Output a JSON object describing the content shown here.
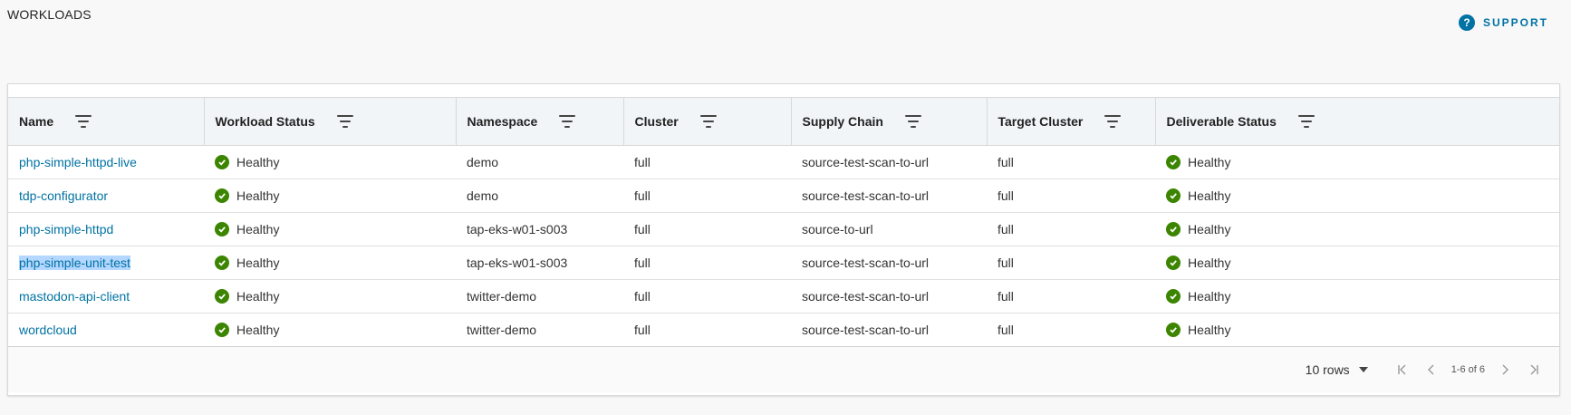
{
  "page": {
    "title": "WORKLOADS"
  },
  "support": {
    "label": "SUPPORT",
    "icon": "help-circle-icon",
    "color": "#0072a3"
  },
  "table": {
    "columns": [
      "Name",
      "Workload Status",
      "Namespace",
      "Cluster",
      "Supply Chain",
      "Target Cluster",
      "Deliverable Status"
    ],
    "rows": [
      {
        "name": "php-simple-httpd-live",
        "workload_status": "Healthy",
        "namespace": "demo",
        "cluster": "full",
        "supply_chain": "source-test-scan-to-url",
        "target_cluster": "full",
        "deliverable_status": "Healthy"
      },
      {
        "name": "tdp-configurator",
        "workload_status": "Healthy",
        "namespace": "demo",
        "cluster": "full",
        "supply_chain": "source-test-scan-to-url",
        "target_cluster": "full",
        "deliverable_status": "Healthy"
      },
      {
        "name": "php-simple-httpd",
        "workload_status": "Healthy",
        "namespace": "tap-eks-w01-s003",
        "cluster": "full",
        "supply_chain": "source-to-url",
        "target_cluster": "full",
        "deliverable_status": "Healthy"
      },
      {
        "name": "php-simple-unit-test",
        "workload_status": "Healthy",
        "namespace": "tap-eks-w01-s003",
        "cluster": "full",
        "supply_chain": "source-test-scan-to-url",
        "target_cluster": "full",
        "deliverable_status": "Healthy",
        "selected": true
      },
      {
        "name": "mastodon-api-client",
        "workload_status": "Healthy",
        "namespace": "twitter-demo",
        "cluster": "full",
        "supply_chain": "source-test-scan-to-url",
        "target_cluster": "full",
        "deliverable_status": "Healthy"
      },
      {
        "name": "wordcloud",
        "workload_status": "Healthy",
        "namespace": "twitter-demo",
        "cluster": "full",
        "supply_chain": "source-test-scan-to-url",
        "target_cluster": "full",
        "deliverable_status": "Healthy"
      }
    ]
  },
  "footer": {
    "rows_per_page": "10 rows",
    "page_info": "1-6 of 6"
  },
  "colors": {
    "link": "#0072a3",
    "healthy": "#3c8500",
    "selection": "#b3d7ff"
  }
}
